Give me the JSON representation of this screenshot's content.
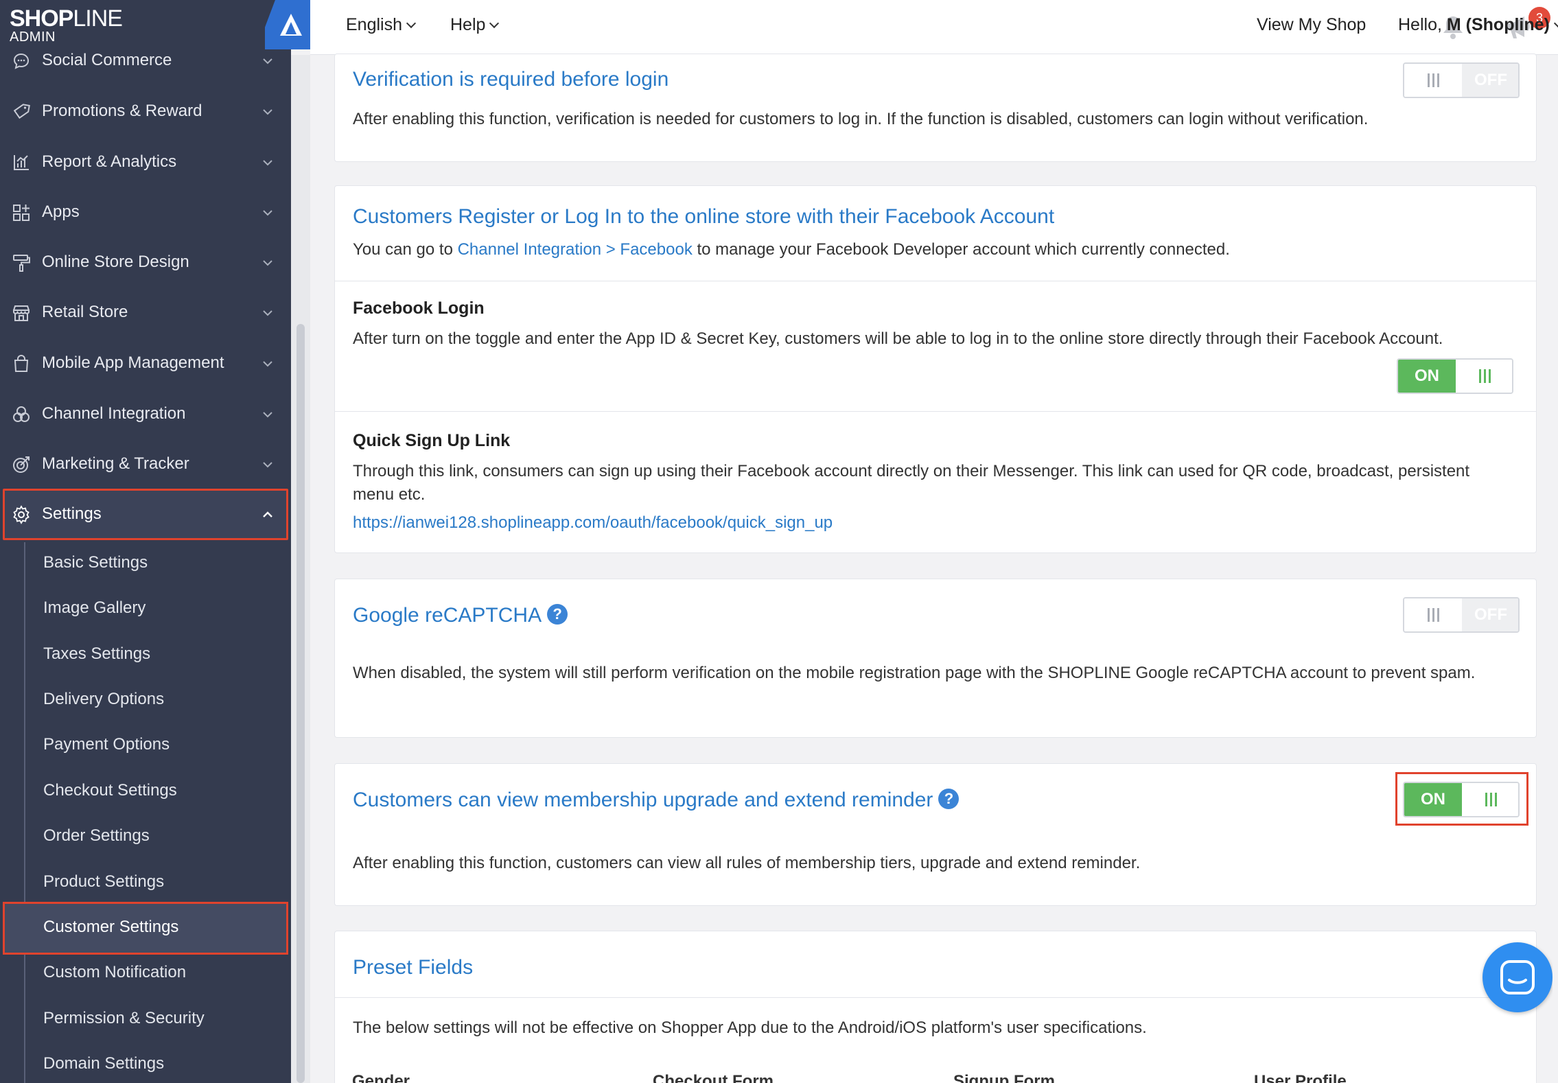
{
  "app": {
    "logo_text": "SHOPLINE",
    "logo_sub": "ADMIN",
    "accent": "#2a7ac7",
    "highlight_color": "#e0432d",
    "toggle_on_color": "#5cb85c"
  },
  "sidebar": {
    "items": [
      {
        "label": "Social Commerce",
        "icon": "chat-bubble-icon"
      },
      {
        "label": "Promotions & Reward",
        "icon": "tag-icon"
      },
      {
        "label": "Report & Analytics",
        "icon": "bar-chart-icon"
      },
      {
        "label": "Apps",
        "icon": "apps-grid-icon"
      },
      {
        "label": "Online Store Design",
        "icon": "paint-roller-icon"
      },
      {
        "label": "Retail Store",
        "icon": "storefront-icon"
      },
      {
        "label": "Mobile App Management",
        "icon": "shopping-bag-icon"
      },
      {
        "label": "Channel Integration",
        "icon": "channels-icon"
      },
      {
        "label": "Marketing & Tracker",
        "icon": "target-icon"
      },
      {
        "label": "Settings",
        "icon": "gear-icon",
        "expanded": true
      }
    ],
    "settings_sub": [
      "Basic Settings",
      "Image Gallery",
      "Taxes Settings",
      "Delivery Options",
      "Payment Options",
      "Checkout Settings",
      "Order Settings",
      "Product Settings",
      "Customer Settings",
      "Custom Notification",
      "Permission & Security",
      "Domain Settings"
    ],
    "active_sub": "Customer Settings"
  },
  "topbar": {
    "language": "English",
    "help": "Help",
    "notification_count": "3",
    "view_shop": "View My Shop",
    "hello_prefix": "Hello, ",
    "hello_name": "M (Shopline)"
  },
  "cards": {
    "verification": {
      "title": "Verification is required before login",
      "text": "After enabling this function, verification is needed for customers to log in. If the function is disabled, customers can login without verification.",
      "toggle": "OFF"
    },
    "facebook": {
      "title": "Customers Register or Log In to the online store with their Facebook Account",
      "text_before": "You can go to ",
      "text_link": "Channel Integration > Facebook",
      "text_after": " to manage your Facebook Developer account which currently connected.",
      "login_title": "Facebook Login",
      "login_text": "After turn on the toggle and enter the App ID & Secret Key, customers will be able to log in to the online store directly through their Facebook Account.",
      "login_toggle": "ON",
      "quick_title": "Quick Sign Up Link",
      "quick_text": "Through this link, consumers can sign up using their Facebook account directly on their Messenger. This link can used for QR code, broadcast, persistent menu etc.",
      "quick_link": "https://ianwei128.shoplineapp.com/oauth/facebook/quick_sign_up"
    },
    "recaptcha": {
      "title": "Google reCAPTCHA",
      "text": "When disabled, the system will still perform verification on the mobile registration page with the SHOPLINE Google reCAPTCHA account to prevent spam.",
      "toggle": "OFF"
    },
    "membership": {
      "title": "Customers can view membership upgrade and extend reminder",
      "text": "After enabling this function, customers can view all rules of membership tiers, upgrade and extend reminder.",
      "toggle": "ON"
    },
    "preset": {
      "title": "Preset Fields",
      "text": "The below settings will not be effective on Shopper App due to the Android/iOS platform's user specifications.",
      "columns": [
        "Gender",
        "Checkout Form",
        "Signup Form",
        "User Profile"
      ]
    }
  }
}
